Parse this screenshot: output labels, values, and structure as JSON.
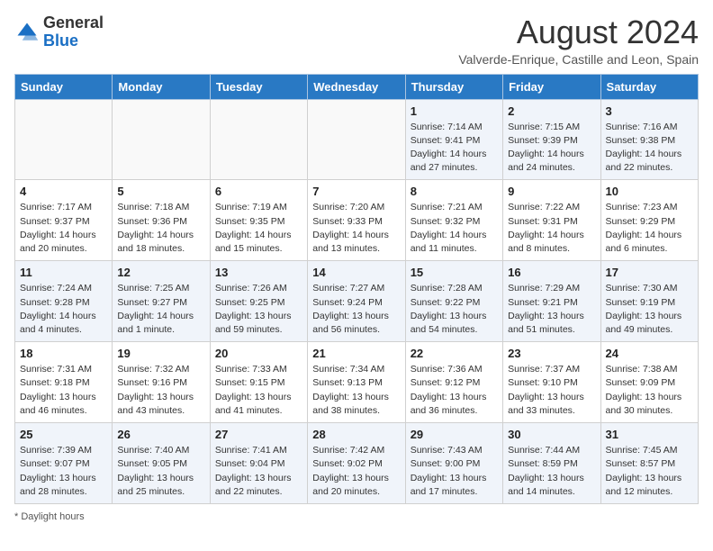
{
  "header": {
    "logo_general": "General",
    "logo_blue": "Blue",
    "month_year": "August 2024",
    "location": "Valverde-Enrique, Castille and Leon, Spain"
  },
  "footer": {
    "daylight_hours": "Daylight hours"
  },
  "columns": [
    "Sunday",
    "Monday",
    "Tuesday",
    "Wednesday",
    "Thursday",
    "Friday",
    "Saturday"
  ],
  "weeks": [
    [
      {
        "day": "",
        "info": ""
      },
      {
        "day": "",
        "info": ""
      },
      {
        "day": "",
        "info": ""
      },
      {
        "day": "",
        "info": ""
      },
      {
        "day": "1",
        "info": "Sunrise: 7:14 AM\nSunset: 9:41 PM\nDaylight: 14 hours\nand 27 minutes."
      },
      {
        "day": "2",
        "info": "Sunrise: 7:15 AM\nSunset: 9:39 PM\nDaylight: 14 hours\nand 24 minutes."
      },
      {
        "day": "3",
        "info": "Sunrise: 7:16 AM\nSunset: 9:38 PM\nDaylight: 14 hours\nand 22 minutes."
      }
    ],
    [
      {
        "day": "4",
        "info": "Sunrise: 7:17 AM\nSunset: 9:37 PM\nDaylight: 14 hours\nand 20 minutes."
      },
      {
        "day": "5",
        "info": "Sunrise: 7:18 AM\nSunset: 9:36 PM\nDaylight: 14 hours\nand 18 minutes."
      },
      {
        "day": "6",
        "info": "Sunrise: 7:19 AM\nSunset: 9:35 PM\nDaylight: 14 hours\nand 15 minutes."
      },
      {
        "day": "7",
        "info": "Sunrise: 7:20 AM\nSunset: 9:33 PM\nDaylight: 14 hours\nand 13 minutes."
      },
      {
        "day": "8",
        "info": "Sunrise: 7:21 AM\nSunset: 9:32 PM\nDaylight: 14 hours\nand 11 minutes."
      },
      {
        "day": "9",
        "info": "Sunrise: 7:22 AM\nSunset: 9:31 PM\nDaylight: 14 hours\nand 8 minutes."
      },
      {
        "day": "10",
        "info": "Sunrise: 7:23 AM\nSunset: 9:29 PM\nDaylight: 14 hours\nand 6 minutes."
      }
    ],
    [
      {
        "day": "11",
        "info": "Sunrise: 7:24 AM\nSunset: 9:28 PM\nDaylight: 14 hours\nand 4 minutes."
      },
      {
        "day": "12",
        "info": "Sunrise: 7:25 AM\nSunset: 9:27 PM\nDaylight: 14 hours\nand 1 minute."
      },
      {
        "day": "13",
        "info": "Sunrise: 7:26 AM\nSunset: 9:25 PM\nDaylight: 13 hours\nand 59 minutes."
      },
      {
        "day": "14",
        "info": "Sunrise: 7:27 AM\nSunset: 9:24 PM\nDaylight: 13 hours\nand 56 minutes."
      },
      {
        "day": "15",
        "info": "Sunrise: 7:28 AM\nSunset: 9:22 PM\nDaylight: 13 hours\nand 54 minutes."
      },
      {
        "day": "16",
        "info": "Sunrise: 7:29 AM\nSunset: 9:21 PM\nDaylight: 13 hours\nand 51 minutes."
      },
      {
        "day": "17",
        "info": "Sunrise: 7:30 AM\nSunset: 9:19 PM\nDaylight: 13 hours\nand 49 minutes."
      }
    ],
    [
      {
        "day": "18",
        "info": "Sunrise: 7:31 AM\nSunset: 9:18 PM\nDaylight: 13 hours\nand 46 minutes."
      },
      {
        "day": "19",
        "info": "Sunrise: 7:32 AM\nSunset: 9:16 PM\nDaylight: 13 hours\nand 43 minutes."
      },
      {
        "day": "20",
        "info": "Sunrise: 7:33 AM\nSunset: 9:15 PM\nDaylight: 13 hours\nand 41 minutes."
      },
      {
        "day": "21",
        "info": "Sunrise: 7:34 AM\nSunset: 9:13 PM\nDaylight: 13 hours\nand 38 minutes."
      },
      {
        "day": "22",
        "info": "Sunrise: 7:36 AM\nSunset: 9:12 PM\nDaylight: 13 hours\nand 36 minutes."
      },
      {
        "day": "23",
        "info": "Sunrise: 7:37 AM\nSunset: 9:10 PM\nDaylight: 13 hours\nand 33 minutes."
      },
      {
        "day": "24",
        "info": "Sunrise: 7:38 AM\nSunset: 9:09 PM\nDaylight: 13 hours\nand 30 minutes."
      }
    ],
    [
      {
        "day": "25",
        "info": "Sunrise: 7:39 AM\nSunset: 9:07 PM\nDaylight: 13 hours\nand 28 minutes."
      },
      {
        "day": "26",
        "info": "Sunrise: 7:40 AM\nSunset: 9:05 PM\nDaylight: 13 hours\nand 25 minutes."
      },
      {
        "day": "27",
        "info": "Sunrise: 7:41 AM\nSunset: 9:04 PM\nDaylight: 13 hours\nand 22 minutes."
      },
      {
        "day": "28",
        "info": "Sunrise: 7:42 AM\nSunset: 9:02 PM\nDaylight: 13 hours\nand 20 minutes."
      },
      {
        "day": "29",
        "info": "Sunrise: 7:43 AM\nSunset: 9:00 PM\nDaylight: 13 hours\nand 17 minutes."
      },
      {
        "day": "30",
        "info": "Sunrise: 7:44 AM\nSunset: 8:59 PM\nDaylight: 13 hours\nand 14 minutes."
      },
      {
        "day": "31",
        "info": "Sunrise: 7:45 AM\nSunset: 8:57 PM\nDaylight: 13 hours\nand 12 minutes."
      }
    ]
  ]
}
